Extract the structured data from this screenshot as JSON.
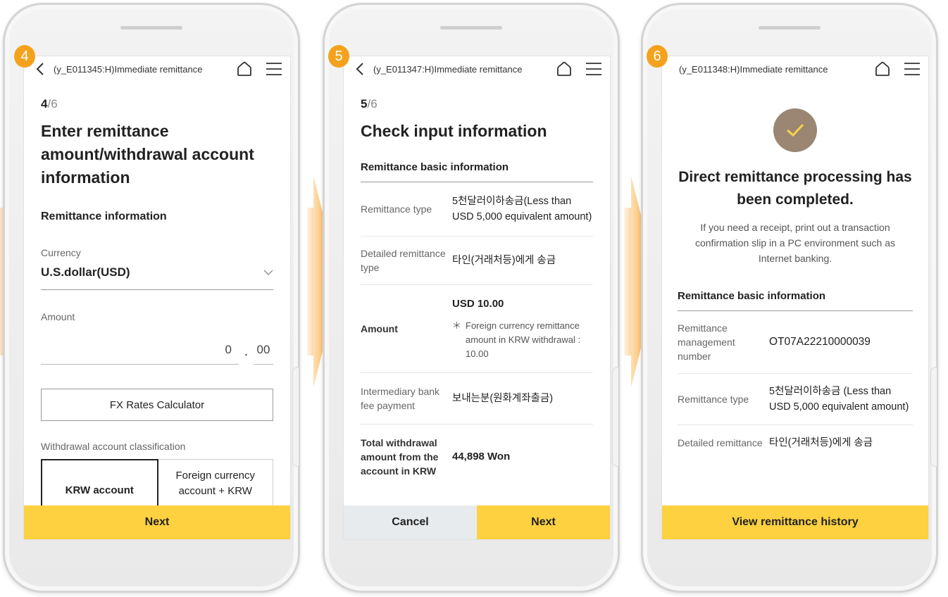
{
  "badges": [
    "4",
    "5",
    "6"
  ],
  "screen4": {
    "topbar_title": "(y_E011345:H)Immediate remittance",
    "step_current": "4",
    "step_total": "/6",
    "heading": "Enter remittance amount/withdrawal account information",
    "section_title": "Remittance information",
    "currency_label": "Currency",
    "currency_value": "U.S.dollar(USD)",
    "amount_label": "Amount",
    "amount_int": "0",
    "amount_sep": ".",
    "amount_dec": "00",
    "calc_button": "FX Rates Calculator",
    "withdrawal_label": "Withdrawal account classification",
    "account_options": [
      "KRW account",
      "Foreign currency account + KRW"
    ],
    "next_button": "Next"
  },
  "screen5": {
    "topbar_title": "(y_E011347:H)Immediate remittance",
    "step_current": "5",
    "step_total": "/6",
    "heading": "Check input information",
    "section_title": "Remittance basic information",
    "rows": [
      {
        "key": "Remittance type",
        "value": "5천달러이하송금(Less than USD 5,000 equivalent amount)"
      },
      {
        "key": "Detailed remittance type",
        "value": "타인(거래처등)에게 송금"
      },
      {
        "key": "Amount",
        "value": "USD 10.00",
        "note": "Foreign currency remittance amount in KRW withdrawal : 10.00"
      },
      {
        "key": "Intermediary bank fee payment",
        "value": "보내는분(원화계좌출금)"
      },
      {
        "key": "Total withdrawal amount from the account in KRW",
        "value": "44,898 Won"
      }
    ],
    "note_mark": "＊",
    "cancel_button": "Cancel",
    "next_button": "Next"
  },
  "screen6": {
    "topbar_title": "(y_E011348:H)Immediate remittance",
    "done_title": "Direct remittance processing has been completed.",
    "done_desc": "If you need a receipt, print out a transaction confirmation slip in a PC environment such as Internet banking.",
    "section_title": "Remittance basic information",
    "rows": [
      {
        "key": "Remittance management number",
        "value": "OT07A22210000039"
      },
      {
        "key": "Remittance type",
        "value": "5천달러이하송금 (Less than USD 5,000 equivalent amount)"
      },
      {
        "key": "Detailed remittance",
        "value": "타인(거래처등)에게 송금"
      }
    ],
    "history_button": "View remittance history"
  },
  "colors": {
    "accent_yellow": "#fdd13f",
    "badge_orange": "#f4a21d",
    "check_brown": "#9a8673"
  },
  "icons": [
    "back-icon",
    "home-icon",
    "menu-icon",
    "chevron-down-icon",
    "check-icon"
  ]
}
